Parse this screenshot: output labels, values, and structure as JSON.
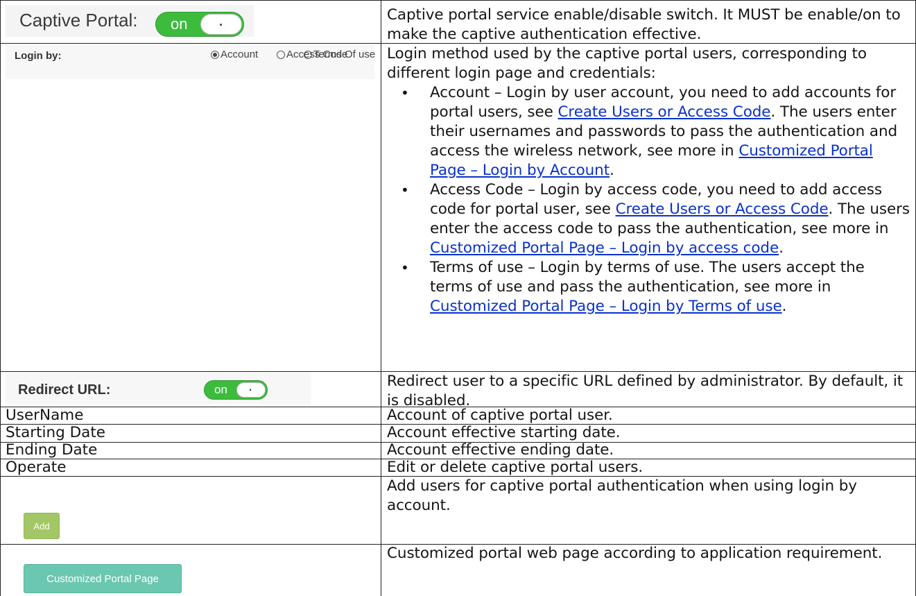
{
  "rows": {
    "captive_portal": {
      "label": "Captive Portal:",
      "toggle": "on",
      "knob": ".",
      "desc": "Captive portal service enable/disable switch. It MUST be enable/on to make the captive authentication effective."
    },
    "login_by": {
      "label": "Login by:",
      "options": [
        "Account",
        "Access Code",
        "Terms Of use"
      ],
      "selected": "Account",
      "intro": "Login method used by the captive portal users, corresponding to different login page and credentials:",
      "bullets": {
        "account": {
          "text_a": "Account – Login by user account, you need to add accounts for portal users, see ",
          "link_a": "Create Users or Access Code",
          "text_b": ". The users enter their usernames and passwords to pass the authentication and access the wireless network, see more in ",
          "link_b": "Customized Portal Page – Login by Account",
          "text_c": "."
        },
        "access_code": {
          "text_a": "Access Code – Login by access code, you need to add access code for portal user, see ",
          "link_a": "Create Users or Access Code",
          "text_b": ". The users enter the access code to pass the authentication, see more in ",
          "link_b": "Customized Portal Page – Login by access code",
          "text_c": "."
        },
        "terms": {
          "text_a": "Terms of use – Login by terms of use. The users accept the terms of use and pass the authentication, see more in ",
          "link_b": "Customized Portal Page – Login by Terms of use",
          "text_c": "."
        }
      }
    },
    "redirect_url": {
      "label": "Redirect URL:",
      "toggle": "on",
      "knob": ".",
      "desc": "Redirect user to a specific URL defined by administrator. By default, it is disabled."
    },
    "username": {
      "label": "UserName",
      "desc": "Account of captive portal user."
    },
    "starting_date": {
      "label": "Starting Date",
      "desc": "Account effective starting date."
    },
    "ending_date": {
      "label": "Ending Date",
      "desc": "Account effective ending date."
    },
    "operate": {
      "label": "Operate",
      "desc": "Edit or delete captive portal users."
    },
    "add": {
      "button": "Add",
      "desc": "Add users for captive portal authentication when using login by account."
    },
    "customized": {
      "button": "Customized Portal Page",
      "desc": "Customized portal web page according to application requirement."
    }
  },
  "colors": {
    "link": "#0a31cc",
    "toggle_on": "#3dbb3d",
    "add_button": "#a3c766",
    "portal_button": "#6cc7b0"
  }
}
